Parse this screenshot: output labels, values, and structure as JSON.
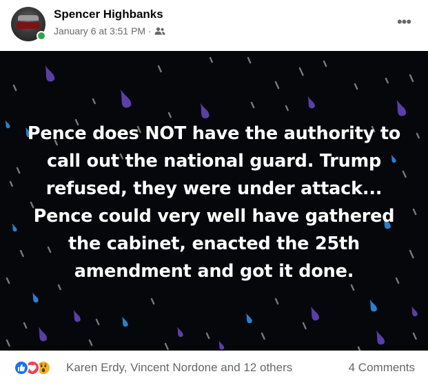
{
  "post": {
    "author": "Spencer Highbanks",
    "timestamp": "January 6 at 3:51 PM",
    "separator": "·",
    "audience_icon": "friends-icon",
    "more_icon": "more-options-icon",
    "text_lines": [
      "Pence does NOT have the authority to",
      "call out the national guard. Trump",
      "refused, they were under attack...",
      "Pence could very well have gathered",
      "the cabinet, enacted the 25th",
      "amendment and got it done."
    ],
    "background": {
      "base_color": "#05070b",
      "drop_colors": [
        "#5b3ea8",
        "#2a7fd0",
        "#7a7a7a"
      ]
    }
  },
  "footer": {
    "reaction_icons": [
      "like-icon",
      "love-icon",
      "wow-icon"
    ],
    "reactors": "Karen Erdy, Vincent Nordone and 12 others",
    "comments": "4 Comments"
  },
  "colors": {
    "accent_like": "#1b74e4",
    "accent_love": "#f33e58",
    "accent_wow": "#f7b125",
    "online": "#31a24c",
    "secondary_text": "#65676b"
  }
}
